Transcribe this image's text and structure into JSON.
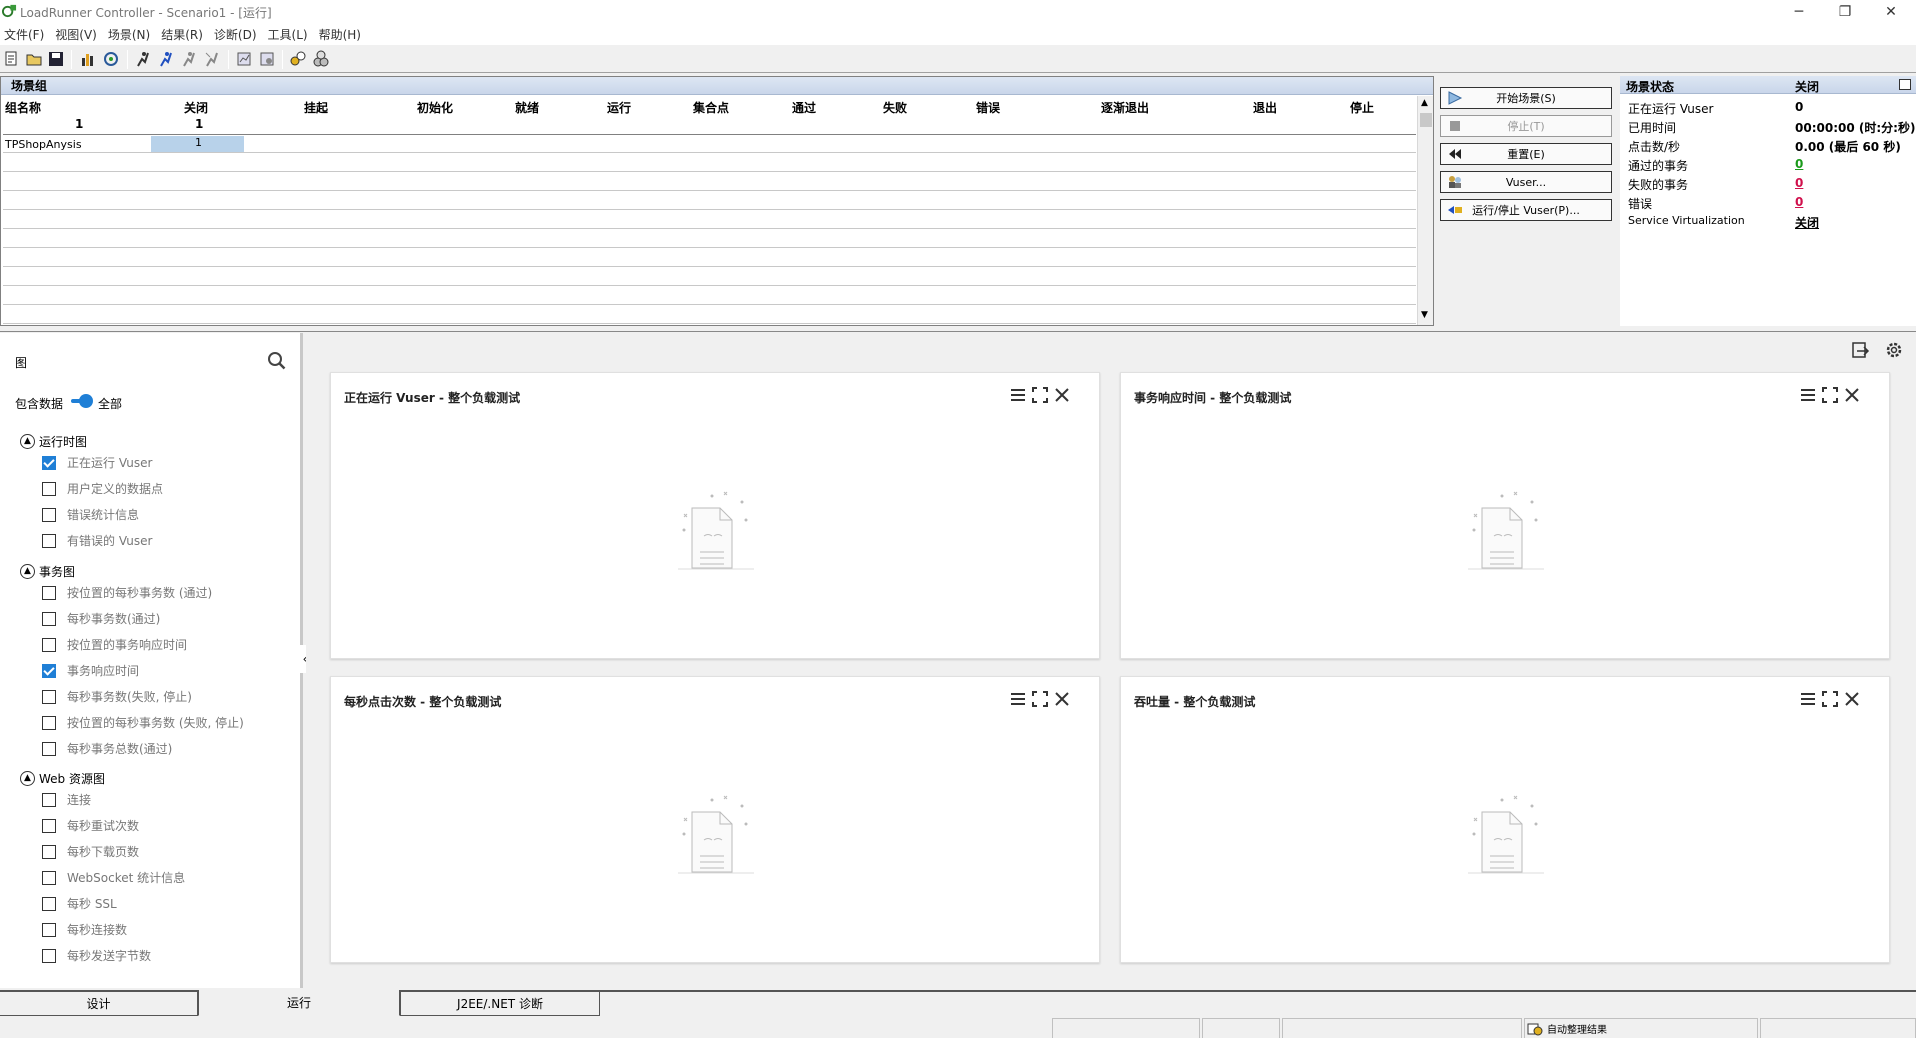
{
  "window": {
    "title": "LoadRunner Controller - Scenario1 - [运行]",
    "minimize": "─",
    "restore": "❐",
    "close": "✕"
  },
  "menu": [
    "文件(F)",
    "视图(V)",
    "场景(N)",
    "结果(R)",
    "诊断(D)",
    "工具(L)",
    "帮助(H)"
  ],
  "toolbar_icons": [
    "new-scenario-icon",
    "open-icon",
    "save-icon",
    "analysis-icon",
    "vuser-gen-icon",
    "run-icon",
    "run-vuser-icon",
    "stop-vuser-icon",
    "reset-vuser-icon",
    "results-icon",
    "results-settings-icon",
    "collate-icon",
    "diagnostics-icon"
  ],
  "scenario_groups": {
    "title": "场景组",
    "columns": [
      "组名称",
      "关闭",
      "挂起",
      "初始化",
      "就绪",
      "运行",
      "集合点",
      "通过",
      "失败",
      "错误",
      "逐渐退出",
      "退出",
      "停止"
    ],
    "totals": [
      "1",
      "1"
    ],
    "rows": [
      {
        "name": "TPShopAnysis",
        "closed": "1"
      }
    ]
  },
  "controls": {
    "start": "开始场景(S)",
    "stop": "停止(T)",
    "reset": "重置(E)",
    "vusers": "Vuser...",
    "run_stop_vusers": "运行/停止 Vuser(P)..."
  },
  "scenario_status": {
    "title": "场景状态",
    "state": "关闭",
    "rows": [
      {
        "label": "正在运行 Vuser",
        "value": "0",
        "color": "#000000"
      },
      {
        "label": "已用时间",
        "value": "00:00:00 (时:分:秒)",
        "color": "#000000"
      },
      {
        "label": "点击数/秒",
        "value": "0.00 (最后 60 秒)",
        "color": "#000000"
      },
      {
        "label": "通过的事务",
        "value": "0",
        "color": "#1a9a1a"
      },
      {
        "label": "失败的事务",
        "value": "0",
        "color": "#d0104c"
      },
      {
        "label": "错误",
        "value": "0",
        "color": "#d0104c"
      },
      {
        "label": "Service Virtualization",
        "value": "关闭",
        "color": "#000000"
      }
    ]
  },
  "graph_tree": {
    "title": "图",
    "include_data_label": "包含数据",
    "include_data_value": "全部",
    "categories": [
      {
        "label": "运行时图",
        "items": [
          {
            "label": "正在运行 Vuser",
            "checked": true
          },
          {
            "label": "用户定义的数据点",
            "checked": false
          },
          {
            "label": "错误统计信息",
            "checked": false
          },
          {
            "label": "有错误的 Vuser",
            "checked": false
          }
        ]
      },
      {
        "label": "事务图",
        "items": [
          {
            "label": "按位置的每秒事务数 (通过)",
            "checked": false
          },
          {
            "label": "每秒事务数(通过)",
            "checked": false
          },
          {
            "label": "按位置的事务响应时间",
            "checked": false
          },
          {
            "label": "事务响应时间",
            "checked": true
          },
          {
            "label": "每秒事务数(失败, 停止)",
            "checked": false
          },
          {
            "label": "按位置的每秒事务数 (失败, 停止)",
            "checked": false
          },
          {
            "label": "每秒事务总数(通过)",
            "checked": false
          }
        ]
      },
      {
        "label": "Web 资源图",
        "items": [
          {
            "label": "连接",
            "checked": false
          },
          {
            "label": "每秒重试次数",
            "checked": false
          },
          {
            "label": "每秒下载页数",
            "checked": false
          },
          {
            "label": "WebSocket 统计信息",
            "checked": false
          },
          {
            "label": "每秒 SSL",
            "checked": false
          },
          {
            "label": "每秒连接数",
            "checked": false
          },
          {
            "label": "每秒发送字节数",
            "checked": false
          }
        ]
      }
    ]
  },
  "graphs": [
    {
      "title": "正在运行 Vuser - 整个负载测试"
    },
    {
      "title": "事务响应时间 - 整个负载测试"
    },
    {
      "title": "每秒点击次数 - 整个负载测试"
    },
    {
      "title": "吞吐量 - 整个负载测试"
    }
  ],
  "tabs": [
    "设计",
    "运行",
    "J2EE/.NET 诊断"
  ],
  "statusbar": {
    "auto_collate": "自动整理结果"
  }
}
